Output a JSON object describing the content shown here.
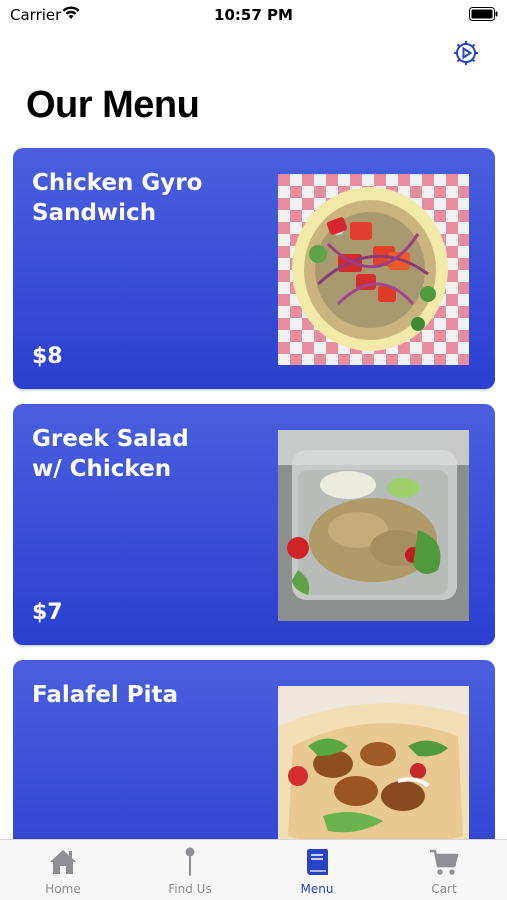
{
  "status_bar": {
    "carrier": "Carrier",
    "time": "10:57 PM",
    "wifi_icon": "wifi-icon",
    "battery_icon": "battery-icon"
  },
  "header": {
    "settings_icon": "gear-play-icon",
    "title": "Our Menu"
  },
  "colors": {
    "card_top": "#4a5fde",
    "card_bottom": "#2b3fd0",
    "accent": "#2744c7",
    "inactive_tab": "#8e8e93"
  },
  "menu_items": [
    {
      "name": "Chicken Gyro\nSandwich",
      "price": "$8"
    },
    {
      "name": "Greek Salad\nw/ Chicken",
      "price": "$7"
    },
    {
      "name": "Falafel Pita",
      "price": ""
    }
  ],
  "tab_bar": {
    "tabs": [
      {
        "label": "Home",
        "icon": "home-icon",
        "active": false
      },
      {
        "label": "Find Us",
        "icon": "map-pin-icon",
        "active": false
      },
      {
        "label": "Menu",
        "icon": "book-icon",
        "active": true
      },
      {
        "label": "Cart",
        "icon": "cart-icon",
        "active": false
      }
    ]
  }
}
